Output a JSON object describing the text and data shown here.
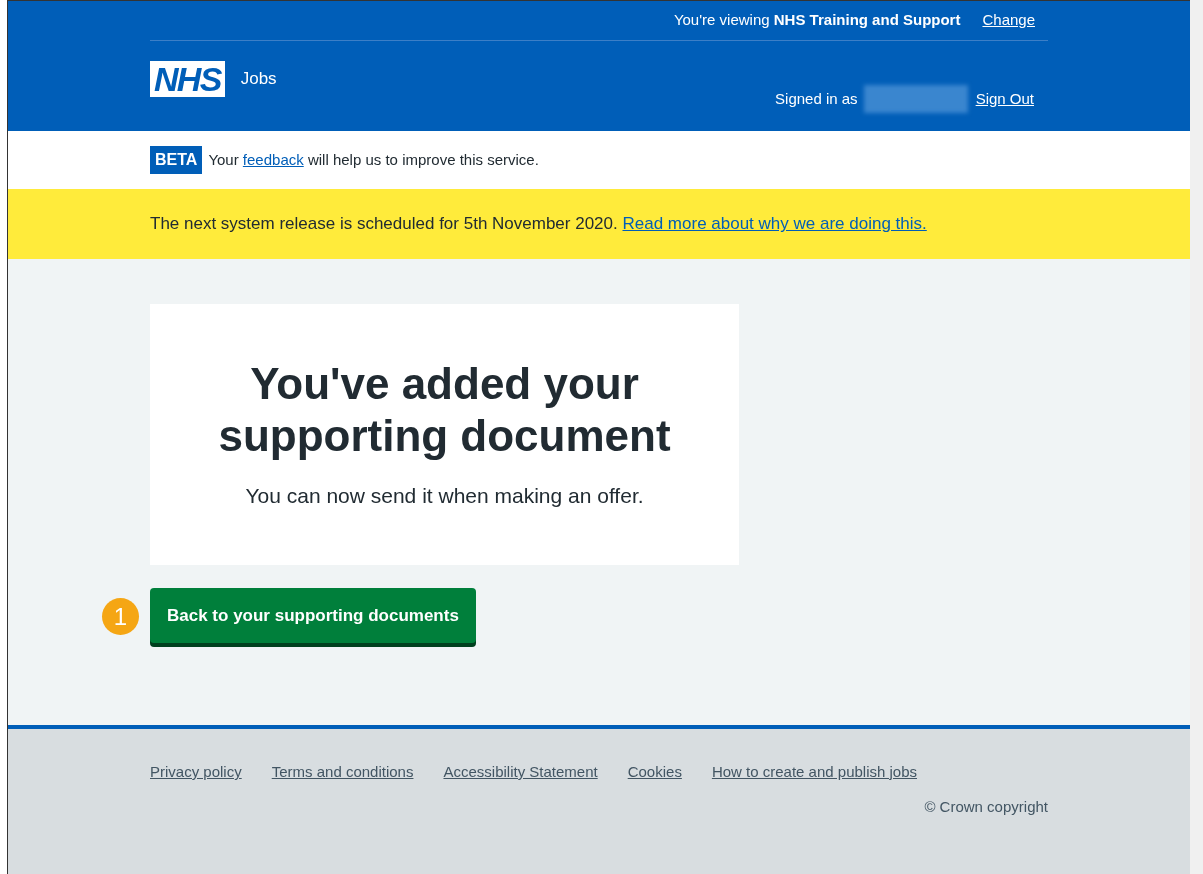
{
  "header": {
    "viewing_prefix": "You're viewing",
    "viewing_org": "NHS Training and Support",
    "change_link": "Change",
    "logo": "NHS",
    "service_name": "Jobs",
    "signed_in_label": "Signed in as",
    "sign_out_link": "Sign Out"
  },
  "beta_banner": {
    "tag": "BETA",
    "text_before": "Your",
    "link": "feedback",
    "text_after": "will help us to improve this service."
  },
  "notice_banner": {
    "text": "The next system release is scheduled for 5th November 2020.",
    "link": "Read more about why we are doing this."
  },
  "confirmation_panel": {
    "title": "You've added your supporting document",
    "body": "You can now send it when making an offer."
  },
  "step_marker": "1",
  "primary_button": "Back to your supporting documents",
  "footer": {
    "links": [
      "Privacy policy",
      "Terms and conditions",
      "Accessibility Statement",
      "Cookies",
      "How to create and publish jobs"
    ],
    "copyright": "© Crown copyright"
  }
}
